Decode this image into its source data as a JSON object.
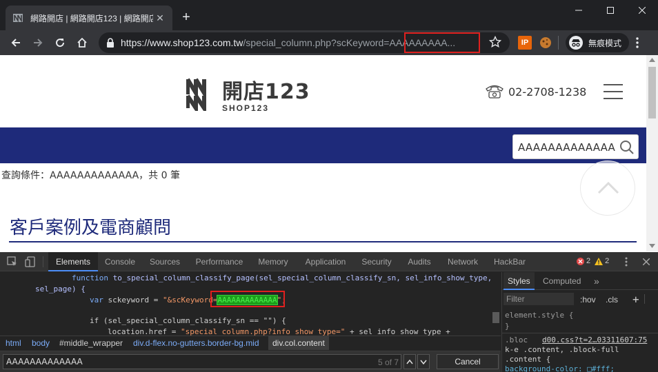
{
  "browser": {
    "tab_title": "網路開店 | 網路開店123 | 網路開店",
    "tab_close": "✕",
    "new_tab": "+",
    "url_host": "https://www.shop123.com.tw",
    "url_path": "/special_column.php?scKeyword=AAAAAAAAA...",
    "incognito_label": "無痕模式",
    "ext_ip_label": "IP"
  },
  "site": {
    "logo_zh": "開店123",
    "logo_en": "SHOP123",
    "phone": "02-2708-1238",
    "search_value": "AAAAAAAAAAAAA",
    "query_result": "查詢條件：AAAAAAAAAAAAA，共 0 筆",
    "heading": "客戶案例及電商顧問",
    "colors": {
      "brand_navy": "#1e2a7a",
      "highlight_red": "#e0201e"
    }
  },
  "devtools": {
    "tabs": [
      "Elements",
      "Console",
      "Sources",
      "Performance",
      "Memory",
      "Application",
      "Security",
      "Audits",
      "Network",
      "HackBar"
    ],
    "active_tab": "Elements",
    "error_count": "2",
    "warning_count": "2",
    "code": {
      "l1_kw": "function",
      "l1_fn": "to_special_column_classify_page",
      "l1_args": "(sel_special_column_classify_sn, sel_info_show_type,",
      "l2": "sel_page) {",
      "l3_kw": "var",
      "l3_var": "sckeyword = ",
      "l3_str_a": "\"&scKeyword=",
      "l3_match": "AAAAAAAAAAAAA",
      "l3_str_b": "\"",
      "l3_end": ";",
      "l4": "if (sel_special_column_classify_sn == \"\") {",
      "l5_a": "location.href = ",
      "l5_str": "\"special_column.php?info_show_type=\"",
      "l5_b": " + sel_info_show_type +"
    },
    "breadcrumbs": [
      "html",
      "body",
      "#middle_wrapper",
      "div.d-flex.no-gutters.border-bg.mid",
      "div.col.content"
    ],
    "find_value": "AAAAAAAAAAAAA",
    "find_count": "5 of 7",
    "cancel_label": "Cancel",
    "styles_tabs": [
      "Styles",
      "Computed"
    ],
    "styles_more": "»",
    "filter_placeholder": "Filter",
    "hov": ":hov",
    "cls": ".cls",
    "styles_lines": [
      "element.style {",
      "}",
      ".bloc",
      "d00.css?t=2…03311607:75",
      "k-e .content, .block-full",
      ".content {",
      "  background-color: □#fff;"
    ]
  }
}
